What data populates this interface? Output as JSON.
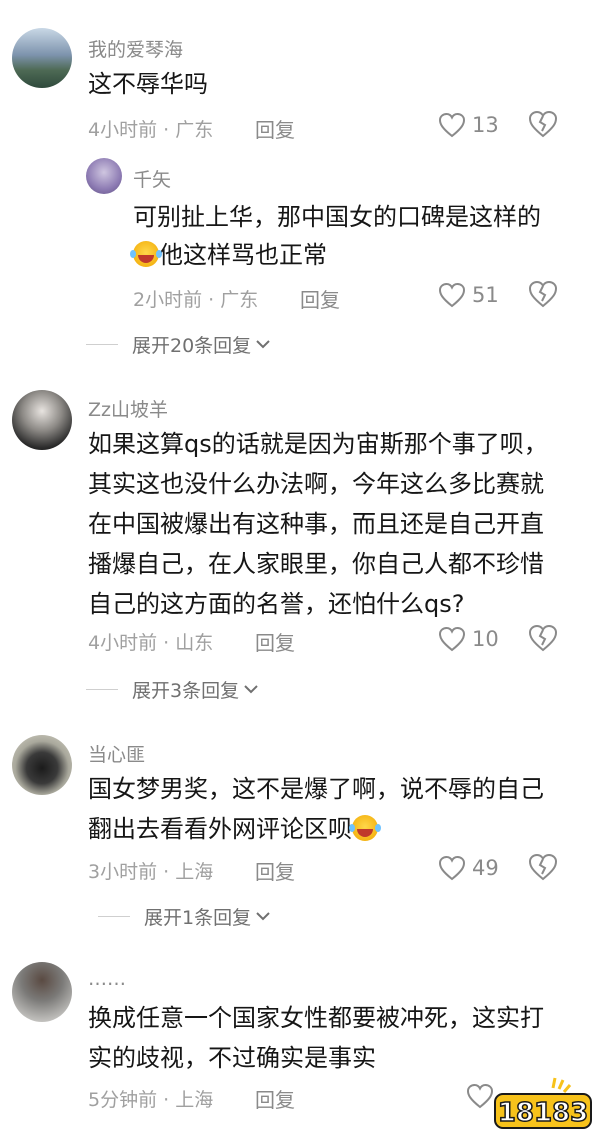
{
  "comments": [
    {
      "username": "我的爱琴海",
      "lines": [
        "这不辱华吗"
      ],
      "meta": "4小时前 · 广东",
      "reply_label": "回复",
      "likes": "13",
      "replies": [
        {
          "username": "千矢",
          "lines": [
            "可别扯上华，那中国女的口碑是这样的",
            "他这样骂也正常"
          ],
          "meta": "2小时前 · 广东",
          "reply_label": "回复",
          "likes": "51"
        }
      ],
      "expand_label": "展开20条回复"
    },
    {
      "username": "Zz山坡羊",
      "lines": [
        "如果这算qs的话就是因为宙斯那个事了呗，",
        "其实这也没什么办法啊，今年这么多比赛就",
        "在中国被爆出有这种事，而且还是自己开直",
        "播爆自己，在人家眼里，你自己人都不珍惜",
        "自己的这方面的名誉，还怕什么qs?"
      ],
      "meta": "4小时前 · 山东",
      "reply_label": "回复",
      "likes": "10",
      "expand_label": "展开3条回复"
    },
    {
      "username": "当心匪",
      "lines": [
        "国女梦男奖，这不是爆了啊，说不辱的自己",
        "翻出去看看外网评论区呗"
      ],
      "meta": "3小时前 · 上海",
      "reply_label": "回复",
      "likes": "49",
      "expand_label": "展开1条回复"
    },
    {
      "username": "……",
      "lines": [
        "换成任意一个国家女性都要被冲死，这实打",
        "实的歧视，不过确实是事实"
      ],
      "meta": "5分钟前 · 上海",
      "reply_label": "回复",
      "likes": ""
    }
  ],
  "watermark": "18183",
  "icons": {
    "like": "heart-outline-icon",
    "dislike": "broken-heart-outline-icon",
    "expand": "chevron-down-icon",
    "emoji": "laughing-crying-emoji"
  },
  "colors": {
    "text": "#161616",
    "muted": "#8a8a8a",
    "meta": "#a0a0a0",
    "brand_yellow": "#f7c21b",
    "brand_outline": "#1a1a1a"
  }
}
